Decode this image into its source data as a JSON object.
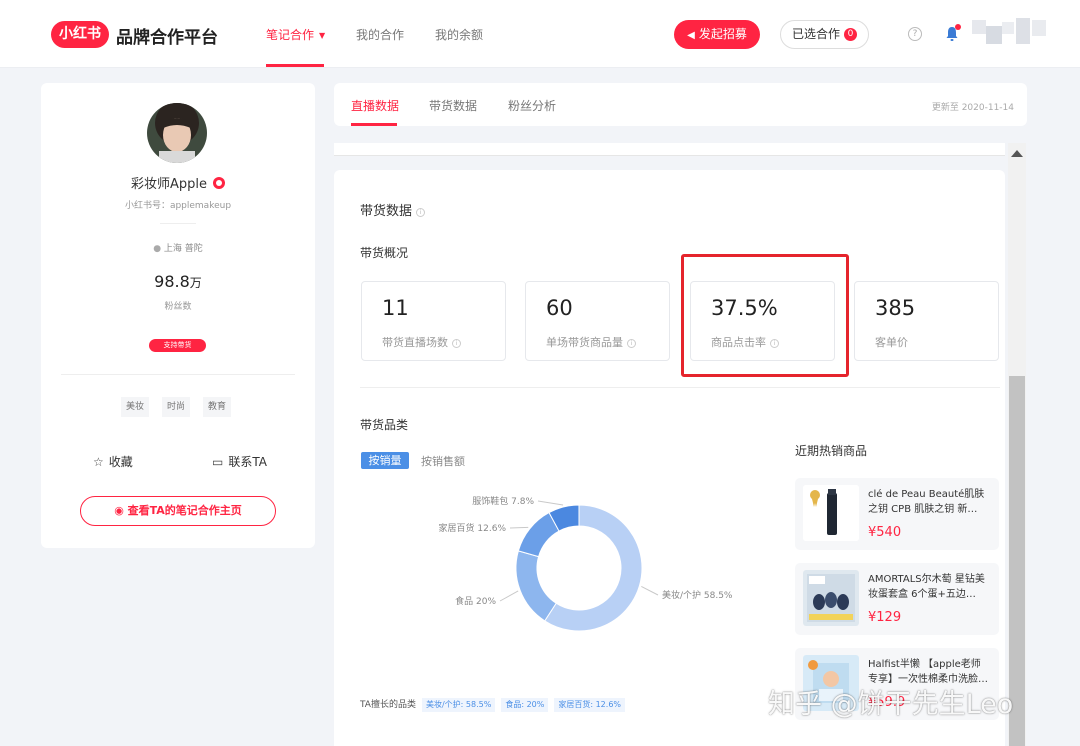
{
  "header": {
    "logo_badge": "小红书",
    "logo_text": "品牌合作平台",
    "nav": [
      {
        "label": "笔记合作"
      },
      {
        "label": "我的合作"
      },
      {
        "label": "我的余额"
      }
    ],
    "recruit_button": "发起招募",
    "selected_button": "已选合作",
    "selected_count": "0",
    "help": "?"
  },
  "profile": {
    "name": "彩妆师Apple",
    "id_text": "小红书号：applemakeup",
    "location": "上海 普陀",
    "fans_value": "98.8",
    "fans_unit": "万",
    "fans_label": "粉丝数",
    "support_badge": "支持带货",
    "tags": [
      "美妆",
      "时尚",
      "教育"
    ],
    "favorite": "收藏",
    "contact": "联系TA",
    "cta": "查看TA的笔记合作主页"
  },
  "tabs": {
    "items": [
      {
        "label": "直播数据"
      },
      {
        "label": "带货数据"
      },
      {
        "label": "粉丝分析"
      }
    ],
    "update_text": "更新至 2020-11-14"
  },
  "main": {
    "title": "带货数据",
    "overview_title": "带货概况",
    "stats": [
      {
        "value": "11",
        "label": "带货直播场数"
      },
      {
        "value": "60",
        "label": "单场带货商品量"
      },
      {
        "value": "37.5%",
        "label": "商品点击率"
      },
      {
        "value": "385",
        "label": "客单价"
      }
    ],
    "category_title": "带货品类",
    "toggle_active": "按销量",
    "toggle_inactive": "按销售额",
    "category_strip_label": "TA擅长的品类",
    "category_strip_tags": [
      "美妆/个护: 58.5%",
      "食品: 20%",
      "家居百货: 12.6%"
    ],
    "hot_title": "近期热销商品",
    "products": [
      {
        "name": "clé de Peau Beauté肌肤之钥 CPB 肌肤之钥 新…",
        "price": "¥540"
      },
      {
        "name": "AMORTALS尔木萄 星钻美妆蛋套盒 6个蛋+五边…",
        "price": "¥129"
      },
      {
        "name": "Halfist半懒 【apple老师专享】一次性棉柔巾洗脸…",
        "price": "¥59.9"
      }
    ]
  },
  "chart_data": {
    "type": "pie",
    "categories": [
      "美妆/个护",
      "食品",
      "家居百货",
      "服饰鞋包"
    ],
    "values": [
      58.5,
      20,
      12.6,
      7.8
    ],
    "labels": [
      "美妆/个护 58.5%",
      "食品 20%",
      "家居百货 12.6%",
      "服饰鞋包 7.8%"
    ],
    "colors": [
      "#b8d0f5",
      "#8db6ee",
      "#6b9fe8",
      "#4b88e0"
    ],
    "donut": true
  },
  "watermark": "知乎 @饼干先生Leo",
  "colors": {
    "brand": "#ff2442",
    "accent_blue": "#4b8fe6",
    "highlight_box": "#e5242c"
  }
}
